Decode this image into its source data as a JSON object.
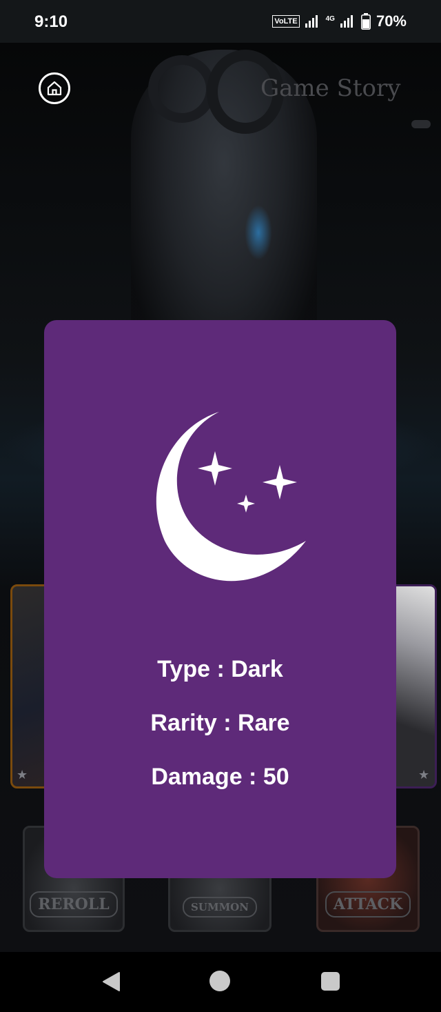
{
  "status_bar": {
    "time": "9:10",
    "network_badge": "VoLTE",
    "network_type": "4G",
    "battery_percent": "70%",
    "icons": [
      "signal-icon",
      "signal-4g-icon",
      "battery-icon"
    ]
  },
  "header": {
    "title": "Game Story",
    "home_icon": "home-icon"
  },
  "actions": {
    "reroll_label": "REROLL",
    "summon_label": "SUMMON",
    "attack_label": "ATTACK"
  },
  "card_detail": {
    "icon": "crescent-moon-stars-icon",
    "type_text": "Type : Dark",
    "rarity_text": "Rarity : Rare",
    "damage_text": "Damage : 50",
    "background_color": "#5e2a79"
  },
  "nav_bar": {
    "icons": [
      "back-icon",
      "home-circle-icon",
      "recents-icon"
    ]
  }
}
